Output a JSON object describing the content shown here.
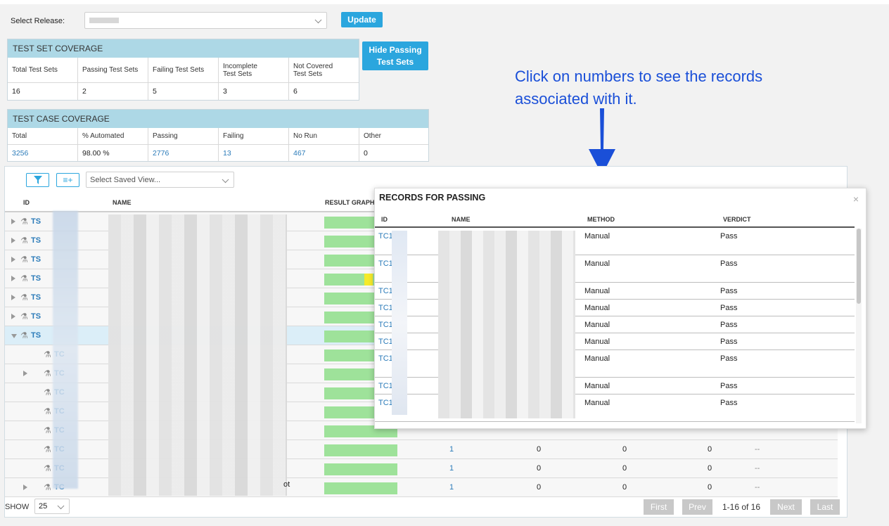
{
  "release": {
    "label": "Select Release:",
    "value": "",
    "update_label": "Update"
  },
  "test_set_coverage": {
    "title": "TEST SET COVERAGE",
    "headers": [
      "Total Test Sets",
      "Passing Test Sets",
      "Failing Test Sets",
      "Incomplete\nTest Sets",
      "Not Covered\nTest Sets"
    ],
    "values": [
      "16",
      "2",
      "5",
      "3",
      "6"
    ]
  },
  "hide_passing_label": "Hide Passing Test Sets",
  "test_case_coverage": {
    "title": "TEST CASE COVERAGE",
    "headers": [
      "Total",
      "% Automated",
      "Passing",
      "Failing",
      "No Run",
      "Other"
    ],
    "values": [
      "3256",
      "98.00 %",
      "2776",
      "13",
      "467",
      "0"
    ]
  },
  "annotation": "Click on numbers to see the records associated with it.",
  "grid": {
    "saved_view_placeholder": "Select Saved View...",
    "columns": {
      "id": "ID",
      "name": "NAME",
      "result_graph": "RESULT GRAPH"
    },
    "rows": [
      {
        "id": "TS",
        "level": 0,
        "expand": "right",
        "icon": "testset-icon"
      },
      {
        "id": "TS",
        "level": 0,
        "expand": "right",
        "icon": "testset-icon"
      },
      {
        "id": "TS",
        "level": 0,
        "expand": "right",
        "icon": "testset-icon"
      },
      {
        "id": "TS",
        "level": 0,
        "expand": "right",
        "icon": "testset-icon",
        "partial": 0.55
      },
      {
        "id": "TS",
        "level": 0,
        "expand": "right",
        "icon": "testset-icon"
      },
      {
        "id": "TS",
        "level": 0,
        "expand": "right",
        "icon": "testset-icon"
      },
      {
        "id": "TS",
        "level": 0,
        "expand": "down",
        "icon": "testset-icon",
        "selected": true
      },
      {
        "id": "TC",
        "level": 1,
        "expand": "",
        "icon": "testcase-icon"
      },
      {
        "id": "TC",
        "level": 1,
        "expand": "right",
        "icon": "testcase-icon"
      },
      {
        "id": "TC",
        "level": 1,
        "expand": "",
        "icon": "testcase-icon"
      },
      {
        "id": "TC",
        "level": 1,
        "expand": "",
        "icon": "testcase-icon"
      },
      {
        "id": "TC",
        "level": 1,
        "expand": "",
        "icon": "testcase-icon"
      },
      {
        "id": "TC",
        "level": 1,
        "expand": "",
        "icon": "testcase-icon",
        "counts": [
          "1",
          "0",
          "0",
          "0",
          "--"
        ]
      },
      {
        "id": "TC",
        "level": 1,
        "expand": "",
        "icon": "testcase-icon",
        "counts": [
          "1",
          "0",
          "0",
          "0",
          "--"
        ]
      },
      {
        "id": "TC",
        "level": 1,
        "expand": "right",
        "icon": "testcase-icon",
        "counts": [
          "1",
          "0",
          "0",
          "0",
          "--"
        ],
        "name_tail": "ot"
      }
    ],
    "footer": {
      "show_label": "SHOW",
      "page_size": "25",
      "first": "First",
      "prev": "Prev",
      "range": "1-16 of 16",
      "next": "Next",
      "last": "Last"
    }
  },
  "popup": {
    "title": "RECORDS FOR PASSING",
    "close": "×",
    "columns": {
      "id": "ID",
      "name": "NAME",
      "method": "METHOD",
      "verdict": "VERDICT"
    },
    "rows": [
      {
        "id": "TC1",
        "method": "Manual",
        "verdict": "Pass",
        "tall": true
      },
      {
        "id": "TC1",
        "method": "Manual",
        "verdict": "Pass",
        "tall": true
      },
      {
        "id": "TC1",
        "method": "Manual",
        "verdict": "Pass"
      },
      {
        "id": "TC1",
        "method": "Manual",
        "verdict": "Pass"
      },
      {
        "id": "TC1",
        "method": "Manual",
        "verdict": "Pass"
      },
      {
        "id": "TC1",
        "method": "Manual",
        "verdict": "Pass"
      },
      {
        "id": "TC1",
        "method": "Manual",
        "verdict": "Pass",
        "tall": true
      },
      {
        "id": "TC1",
        "method": "Manual",
        "verdict": "Pass"
      },
      {
        "id": "TC1",
        "method": "Manual",
        "verdict": "Pass",
        "tall": true
      }
    ]
  },
  "colors": {
    "accent": "#2ba6de",
    "panel_header": "#add8e6",
    "pass_bar": "#9ee29a",
    "annotation": "#1a4fd8"
  }
}
